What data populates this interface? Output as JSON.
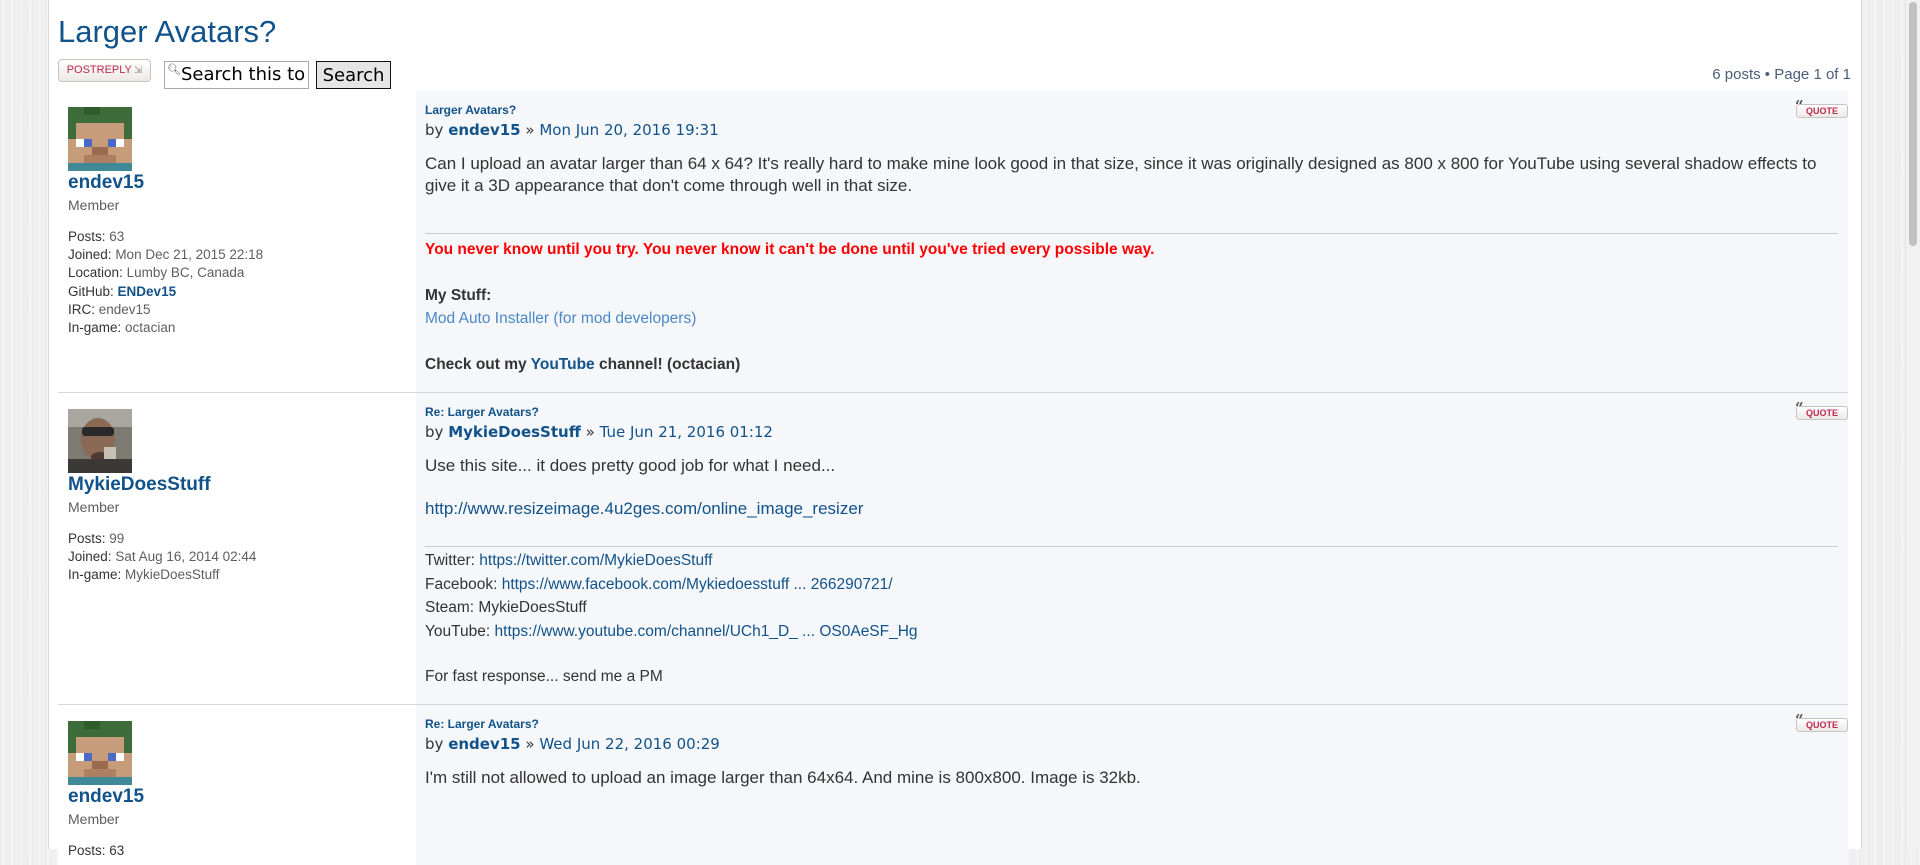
{
  "topic": {
    "title": "Larger Avatars?",
    "post_reply_label": "PostReply",
    "search_value": "Search this to",
    "search_button": "Search",
    "pagination": {
      "posts": "6 posts",
      "separator": "•",
      "page_label": "Page",
      "current": "1",
      "of_label": "of",
      "total": "1"
    }
  },
  "common": {
    "by": "by",
    "raquo": "»",
    "quote_label": "QUOTE"
  },
  "posts": [
    {
      "author": "endev15",
      "rank": "Member",
      "profile": [
        {
          "label": "Posts:",
          "value": "63"
        },
        {
          "label": "Joined:",
          "value": "Mon Dec 21, 2015 22:18"
        },
        {
          "label": "Location:",
          "value": "Lumby BC, Canada"
        },
        {
          "label": "GitHub:",
          "value": "ENDev15"
        },
        {
          "label": "IRC:",
          "value": "endev15"
        },
        {
          "label": "In-game:",
          "value": "octacian"
        }
      ],
      "title": "Larger Avatars?",
      "date": "Mon Jun 20, 2016 19:31",
      "body": "Can I upload an avatar larger than 64 x 64? It's really hard to make mine look good in that size, since it was originally designed as 800 x 800 for YouTube using several shadow effects to give it a 3D appearance that don't come through well in that size.",
      "signature": {
        "motto": "You never know until you try. You never know it can't be done until you've tried every possible way.",
        "stuff_label": "My Stuff:",
        "stuff_link": "Mod Auto Installer (for mod developers)",
        "check_prefix": "Check out my",
        "check_link": "YouTube",
        "check_suffix": "channel! (octacian)"
      }
    },
    {
      "author": "MykieDoesStuff",
      "rank": "Member",
      "profile": [
        {
          "label": "Posts:",
          "value": "99"
        },
        {
          "label": "Joined:",
          "value": "Sat Aug 16, 2014 02:44"
        },
        {
          "label": "In-game:",
          "value": "MykieDoesStuff"
        }
      ],
      "title": "Re: Larger Avatars?",
      "date": "Tue Jun 21, 2016 01:12",
      "body": "Use this site... it does pretty good job for what I need...",
      "body_link": "http://www.resizeimage.4u2ges.com/online_image_resizer",
      "signature": {
        "twitter_label": "Twitter:",
        "twitter_link": "https://twitter.com/MykieDoesStuff",
        "facebook_label": "Facebook:",
        "facebook_link": "https://www.facebook.com/Mykiedoesstuff ... 266290721/",
        "steam_label": "Steam:",
        "steam_value": "MykieDoesStuff",
        "youtube_label": "YouTube:",
        "youtube_link": "https://www.youtube.com/channel/UCh1_D_ ... OS0AeSF_Hg",
        "footer": "For fast response... send me a PM"
      }
    },
    {
      "author": "endev15",
      "rank": "Member",
      "profile_partial": "Posts: 63",
      "title": "Re: Larger Avatars?",
      "date": "Wed Jun 22, 2016 00:29",
      "body": "I'm still not allowed to upload an image larger than 64x64. And mine is 800x800. Image is 32kb."
    }
  ]
}
